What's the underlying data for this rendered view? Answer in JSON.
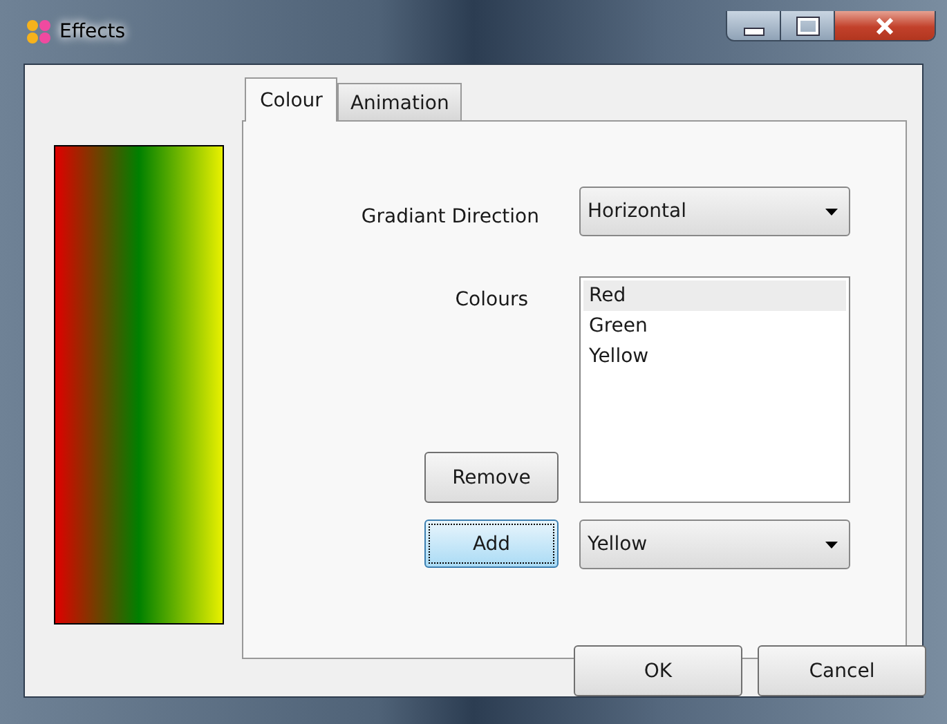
{
  "window": {
    "title": "Effects"
  },
  "tabs": [
    {
      "label": "Colour",
      "selected": true
    },
    {
      "label": "Animation",
      "selected": false
    }
  ],
  "gradient_direction": {
    "label": "Gradiant Direction",
    "value": "Horizontal"
  },
  "colours": {
    "label": "Colours",
    "items": [
      {
        "label": "Red",
        "color": "#e00000",
        "selected": true
      },
      {
        "label": "Green",
        "color": "#008000",
        "selected": false
      },
      {
        "label": "Yellow",
        "color": "#e8f000",
        "selected": false
      }
    ]
  },
  "remove_button": {
    "label": "Remove"
  },
  "add_button": {
    "label": "Add",
    "focused": true
  },
  "new_colour": {
    "value": "Yellow"
  },
  "buttons": [
    "OK",
    "Cancel"
  ]
}
